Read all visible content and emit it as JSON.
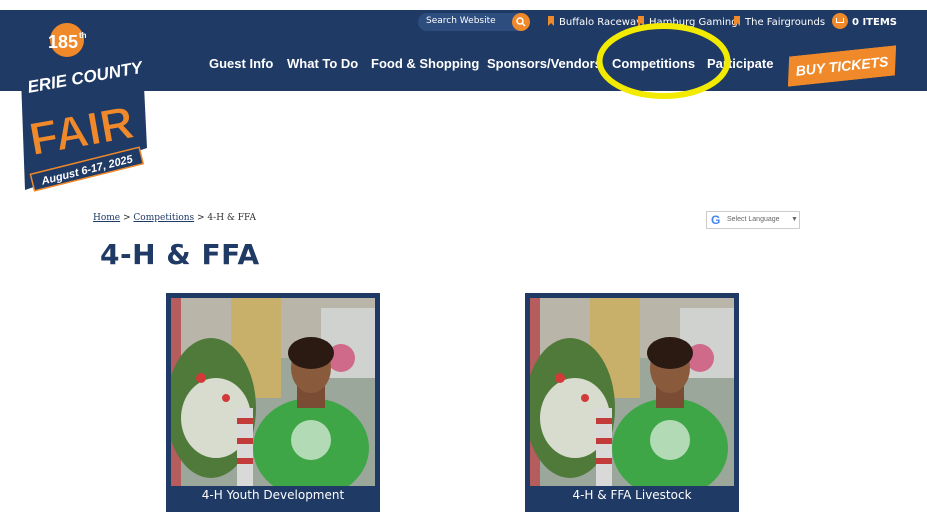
{
  "colors": {
    "navy": "#1f3a64",
    "orange": "#f0892a",
    "highlight": "#f2ea00"
  },
  "topbar": {
    "search_placeholder": "Search Website",
    "links": [
      "Buffalo Raceway",
      "Hamburg Gaming",
      "The Fairgrounds"
    ],
    "cart": "0 ITEMS"
  },
  "logo": {
    "anniversary": "185",
    "suffix": "th",
    "line1": "ERIE COUNTY",
    "line2": "FAIR",
    "dates": "August 6-17, 2025"
  },
  "nav": {
    "items": [
      "Guest Info",
      "What To Do",
      "Food & Shopping",
      "Sponsors/Vendors",
      "Competitions",
      "Participate"
    ],
    "buy_tickets": "BUY TICKETS"
  },
  "breadcrumb": {
    "home": "Home",
    "sep": " > ",
    "competitions": "Competitions",
    "current": "4-H & FFA"
  },
  "translate": {
    "label": "Select Language",
    "arrow": "▼"
  },
  "page_title": "4-H & FFA",
  "cards": [
    {
      "label": "4-H Youth Development"
    },
    {
      "label": "4-H & FFA Livestock"
    }
  ]
}
